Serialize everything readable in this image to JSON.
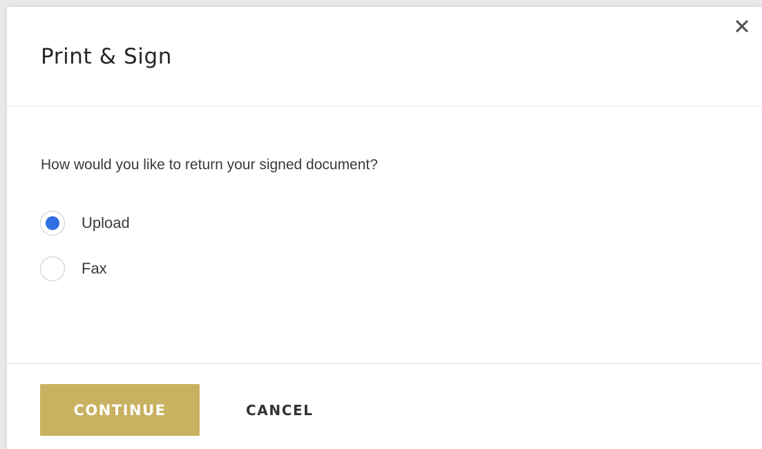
{
  "dialog": {
    "title": "Print & Sign",
    "close_icon": "close-icon",
    "question": "How would you like to return your signed document?",
    "options": [
      {
        "label": "Upload",
        "selected": true
      },
      {
        "label": "Fax",
        "selected": false
      }
    ],
    "continue_label": "CONTINUE",
    "cancel_label": "CANCEL"
  },
  "colors": {
    "accent_button": "#c8b161",
    "radio_selected": "#2f6fe0",
    "divider": "#e3e3e3"
  }
}
